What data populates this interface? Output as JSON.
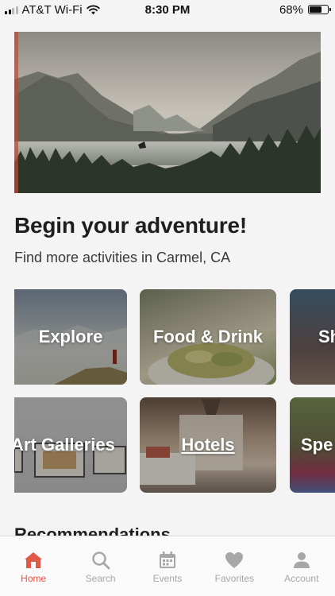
{
  "status_bar": {
    "carrier": "AT&T Wi-Fi",
    "time": "8:30 PM",
    "battery": "68%",
    "battery_level": 0.68
  },
  "hero": {
    "image": "mountain-lake-forest"
  },
  "main": {
    "title": "Begin your adventure!",
    "subtitle": "Find more activities in Carmel, CA",
    "categories": [
      {
        "label": "Explore"
      },
      {
        "label": "Food & Drink"
      },
      {
        "label": "Sh"
      },
      {
        "label": "Art Galleries"
      },
      {
        "label": "Hotels"
      },
      {
        "label": "Spe"
      }
    ],
    "section_heading": "Recommendations"
  },
  "tab_bar": {
    "items": [
      {
        "label": "Home",
        "icon": "home-icon",
        "active": true
      },
      {
        "label": "Search",
        "icon": "search-icon",
        "active": false
      },
      {
        "label": "Events",
        "icon": "calendar-icon",
        "active": false
      },
      {
        "label": "Favorites",
        "icon": "heart-icon",
        "active": false
      },
      {
        "label": "Account",
        "icon": "person-icon",
        "active": false
      }
    ]
  },
  "colors": {
    "accent": "#e0584a",
    "inactive": "#a7a7a7",
    "background": "#f4f4f4"
  }
}
